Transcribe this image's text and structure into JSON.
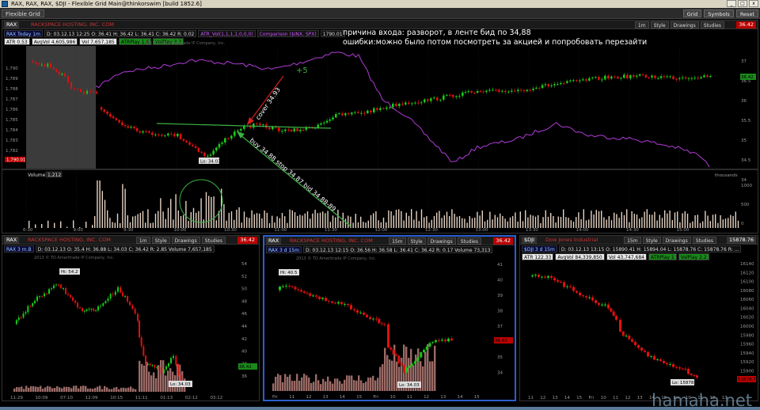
{
  "window": {
    "title": "RAX, RAX, RAX, $DJI - Flexible Grid Main@thinkorswim [build 1852.6]",
    "tab": "Flexible Grid",
    "buttons": [
      "Grid",
      "Symbols",
      "Reset"
    ]
  },
  "main": {
    "symbol": "RAX",
    "description": "RACKSPACE HOSTING, INC. COM",
    "price": "36.42",
    "toolbar": [
      "1m",
      "Style",
      "Drawings",
      "Studies"
    ],
    "info_ticker": "RAX Today 1m",
    "info": "D: 03.12.13 12:25  O: 36.41  H: 36.42  L: 36.41  C: 36.42  R: 0.02",
    "indicator": "ATR_Vol(1,1,1,1,0,0,0)",
    "comparison": "Comparison ($INX, SPX)",
    "comparison_val": "1790.01",
    "atr": "ATR 0.53",
    "avgvol": "AvgVol 4,605,986",
    "vol": "Vol 7,657,185",
    "atrplay": "ATRPlay 1.6",
    "volplay": "VolPlay 3.3",
    "copyright": "2013 © TD Ameritrade IP Company, Inc.",
    "notes": [
      "причина входа: разворот, в ленте бид по 34,88",
      "ошибки:можно было потом посмотреть за акцией и попробовать перезайти"
    ],
    "annotations": {
      "plus": "+5",
      "cover": "cover 34.93",
      "buy": "buy 34.88 stop 34.87 bid 34.88-89",
      "low": "Lo: 34.03"
    },
    "right_axis": [
      "37",
      "36.5",
      "36",
      "35.5",
      "35",
      "34.5",
      "34"
    ],
    "left_axis": [
      "1,790",
      "1,789",
      "1,788",
      "1,787",
      "1,786",
      "1,785",
      "1,784",
      "1,783",
      "1,782",
      "1,781"
    ],
    "left_price": "1,790.01",
    "right_price": "36.42",
    "times": [
      "6:30",
      "9:00",
      "9:30",
      "10:00",
      "10:30",
      "11:00",
      "11:30",
      "12:00",
      "12:30",
      "13:00",
      "13:30",
      "14:00",
      "14:30",
      "15:00"
    ],
    "volume_label": "Volume",
    "volume_value": "1,212",
    "volume_units": "thousands",
    "volume_axis": [
      "1000",
      "500",
      "0"
    ]
  },
  "panels": [
    {
      "symbol": "RAX",
      "description": "RACKSPACE HOSTING, INC. COM",
      "price": "36.42",
      "timeframe": "1m",
      "info_ticker": "RAX 3 m.B",
      "info": "D: 03.12.13  O: 35.4  H: 36.88  L: 34.03  C: 36.42  R: 2.85  Volume 7,657,185",
      "hi": "Hi: 54.2",
      "lo": "Lo: 34.03",
      "last": "36.42",
      "axis": [
        "54",
        "52",
        "50",
        "48",
        "46",
        "44",
        "42",
        "40",
        "38",
        "36"
      ],
      "times": [
        "11:29",
        "10:09",
        "07:10",
        "12:09",
        "10:15",
        "11:11",
        "01:13",
        "02:12",
        "03:12"
      ]
    },
    {
      "symbol": "RAX",
      "description": "RACKSPACE HOSTING, INC. COM",
      "price": "36.42",
      "timeframe": "15m",
      "info_ticker": "RAX 3 d 15m",
      "info": "D: 03.12.13 12:15  O: 36.56  H: 36.58  L: 36.41  C: 36.42  R: 0.17  Volume 73,313",
      "hi": "Hi: 40.5",
      "lo": "Lo: 34.03",
      "last": "36.42",
      "axis": [
        "41",
        "40",
        "39",
        "38",
        "37",
        "36",
        "35",
        "34"
      ],
      "times": [
        "Fri",
        "11",
        "12",
        "13",
        "14",
        "15",
        "Fri",
        "10",
        "11",
        "12",
        "13",
        "14",
        "15"
      ]
    },
    {
      "symbol": "$DJI",
      "description": "Dow Jones Industrial",
      "price": "15878.76",
      "timeframe": "15m",
      "info_ticker": "$DJI 3 d 15m",
      "info": "D: 03.12.13 13:15  O: 15890.41  H: 15894.04  L: 15878.76  C: 15878.76  R: ...",
      "atr": "ATR 122.33",
      "avgvol": "AvgVol 84,339,850",
      "vol": "Vol 43,747,684",
      "atrplay": "ATRPlay 1",
      "volplay": "VolPlay 2.2",
      "lo": "Lo: 15878.6",
      "last": "15878.76",
      "axis": [
        "16140",
        "16120",
        "16100",
        "16080",
        "16060",
        "16040",
        "16020",
        "16000",
        "15980",
        "15960",
        "15940",
        "15920",
        "15900",
        "15880"
      ],
      "times": [
        "11",
        "12",
        "13",
        "14",
        "15",
        "Fri",
        "10",
        "11",
        "12",
        "13",
        "14",
        "15",
        "Fri",
        "10",
        "11",
        "12",
        "13"
      ]
    }
  ],
  "watermark": "hamaha.net",
  "colors": {
    "up": "#19c819",
    "down": "#e01010",
    "comparison": "#b23bd8",
    "volume": "#e6d3c3",
    "annotation_green": "#3cb043",
    "annotation_red": "#d32020"
  }
}
